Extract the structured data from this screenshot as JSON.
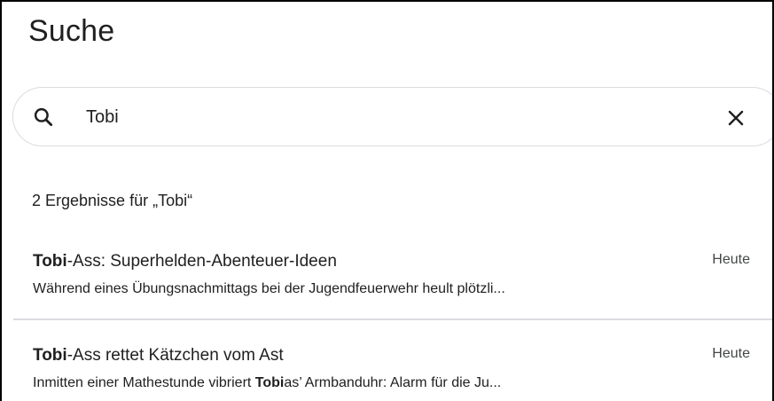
{
  "page": {
    "title": "Suche"
  },
  "search": {
    "value": "Tobi",
    "icon": "search-icon",
    "clear_icon": "close-icon"
  },
  "results_summary": "2 Ergebnisse für „Tobi“",
  "results": [
    {
      "title_match": "Tobi",
      "title_rest": "-Ass: Superhelden-Abenteuer-Ideen",
      "date": "Heute",
      "snippet_before": "Während eines Übungsnachmittags bei der Jugendfeuerwehr heult plötzli...",
      "snippet_match": "",
      "snippet_after": ""
    },
    {
      "title_match": "Tobi",
      "title_rest": "-Ass rettet Kätzchen vom Ast",
      "date": "Heute",
      "snippet_before": "Inmitten einer Mathestunde vibriert ",
      "snippet_match": "Tobi",
      "snippet_after": "as’ Armbanduhr: Alarm für die Ju..."
    }
  ]
}
